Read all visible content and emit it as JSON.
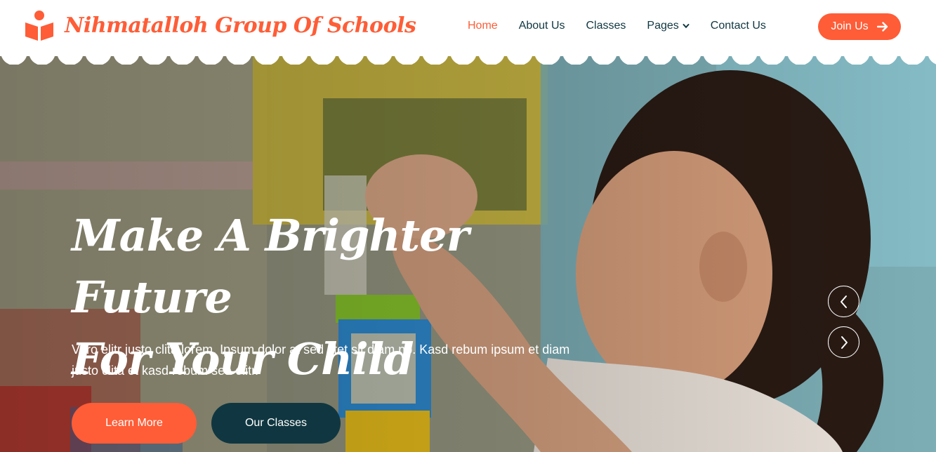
{
  "brand": {
    "name": "Nihmatalloh Group Of Schools",
    "color": "#fe5d37"
  },
  "nav": {
    "items": [
      {
        "label": "Home",
        "active": true
      },
      {
        "label": "About Us"
      },
      {
        "label": "Classes"
      },
      {
        "label": "Pages",
        "has_dropdown": true
      },
      {
        "label": "Contact Us"
      }
    ],
    "join_label": "Join Us",
    "join_icon": "arrow-right-icon"
  },
  "hero": {
    "title_line1": "Make A Brighter Future",
    "title_line2": "For Your Child",
    "text": "Vero elitr justo clita lorem. Ipsum dolor at sed stet sit diam no. Kasd rebum ipsum et diam justo clita et kasd rebum sea elitr.",
    "learn_more_label": "Learn More",
    "our_classes_label": "Our Classes",
    "image_subject": "toddler girl stacking colorful toy blocks",
    "prev_icon": "chevron-left-icon",
    "next_icon": "chevron-right-icon"
  },
  "colors": {
    "primary": "#fe5d37",
    "dark": "#103741",
    "white": "#ffffff"
  }
}
